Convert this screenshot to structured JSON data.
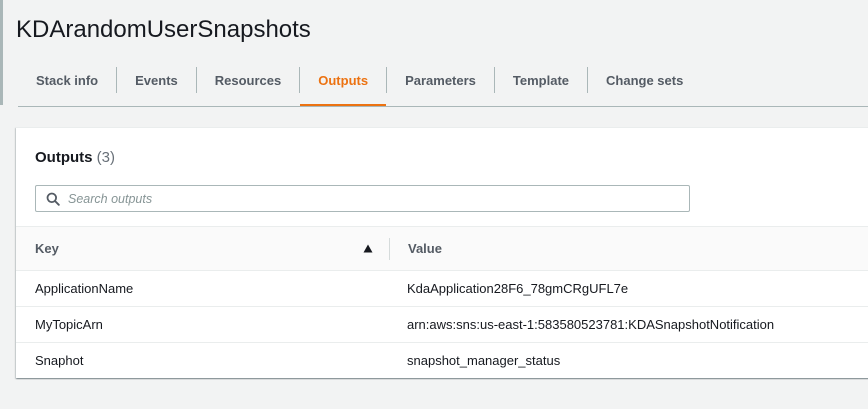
{
  "stack": {
    "title": "KDArandomUserSnapshots"
  },
  "tabs": [
    {
      "label": "Stack info",
      "active": false
    },
    {
      "label": "Events",
      "active": false
    },
    {
      "label": "Resources",
      "active": false
    },
    {
      "label": "Outputs",
      "active": true
    },
    {
      "label": "Parameters",
      "active": false
    },
    {
      "label": "Template",
      "active": false
    },
    {
      "label": "Change sets",
      "active": false
    }
  ],
  "outputs": {
    "title": "Outputs",
    "count": "(3)",
    "search": {
      "placeholder": "Search outputs",
      "value": "",
      "icon": "search-icon"
    },
    "columns": {
      "key": "Key",
      "value": "Value",
      "sort_icon": "sort-ascending-icon"
    },
    "rows": [
      {
        "key": "ApplicationName",
        "value": "KdaApplication28F6_78gmCRgUFL7e"
      },
      {
        "key": "MyTopicArn",
        "value": "arn:aws:sns:us-east-1:583580523781:KDASnapshotNotification"
      },
      {
        "key": "Snaphot",
        "value": "snapshot_manager_status"
      }
    ]
  },
  "colors": {
    "accent": "#ec7211",
    "tab_text": "#545b64",
    "background": "#f2f3f3",
    "panel": "#ffffff"
  }
}
